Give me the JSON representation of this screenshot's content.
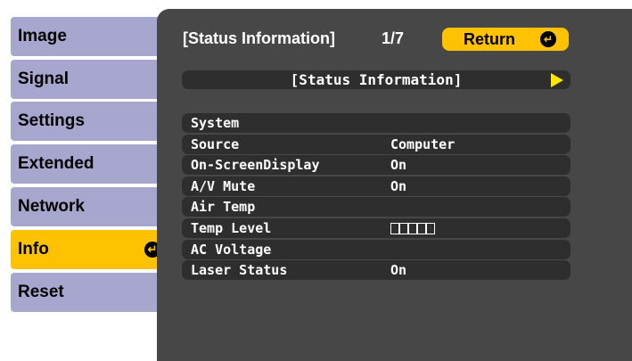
{
  "menu": {
    "items": [
      {
        "label": "Image"
      },
      {
        "label": "Signal"
      },
      {
        "label": "Settings"
      },
      {
        "label": "Extended"
      },
      {
        "label": "Network"
      },
      {
        "label": "Info",
        "active": true
      },
      {
        "label": "Reset"
      }
    ]
  },
  "header": {
    "title": "[Status Information]",
    "page": "1/7",
    "return_label": "Return"
  },
  "section": {
    "label": "[Status Information]"
  },
  "status": {
    "rows": [
      {
        "key": "System",
        "value": ""
      },
      {
        "key": "Source",
        "value": "Computer"
      },
      {
        "key": "On-ScreenDisplay",
        "value": "On"
      },
      {
        "key": "A/V Mute",
        "value": "On"
      },
      {
        "key": "Air Temp",
        "value": ""
      },
      {
        "key": "Temp Level",
        "value": ""
      },
      {
        "key": "AC Voltage",
        "value": ""
      },
      {
        "key": "Laser Status",
        "value": "On"
      }
    ],
    "temp_level_blocks": 5
  },
  "colors": {
    "menu": "#a6a6cf",
    "active": "#ffc200",
    "panel": "#474747",
    "row": "#2e2e2e",
    "arrow": "#ffe600"
  }
}
